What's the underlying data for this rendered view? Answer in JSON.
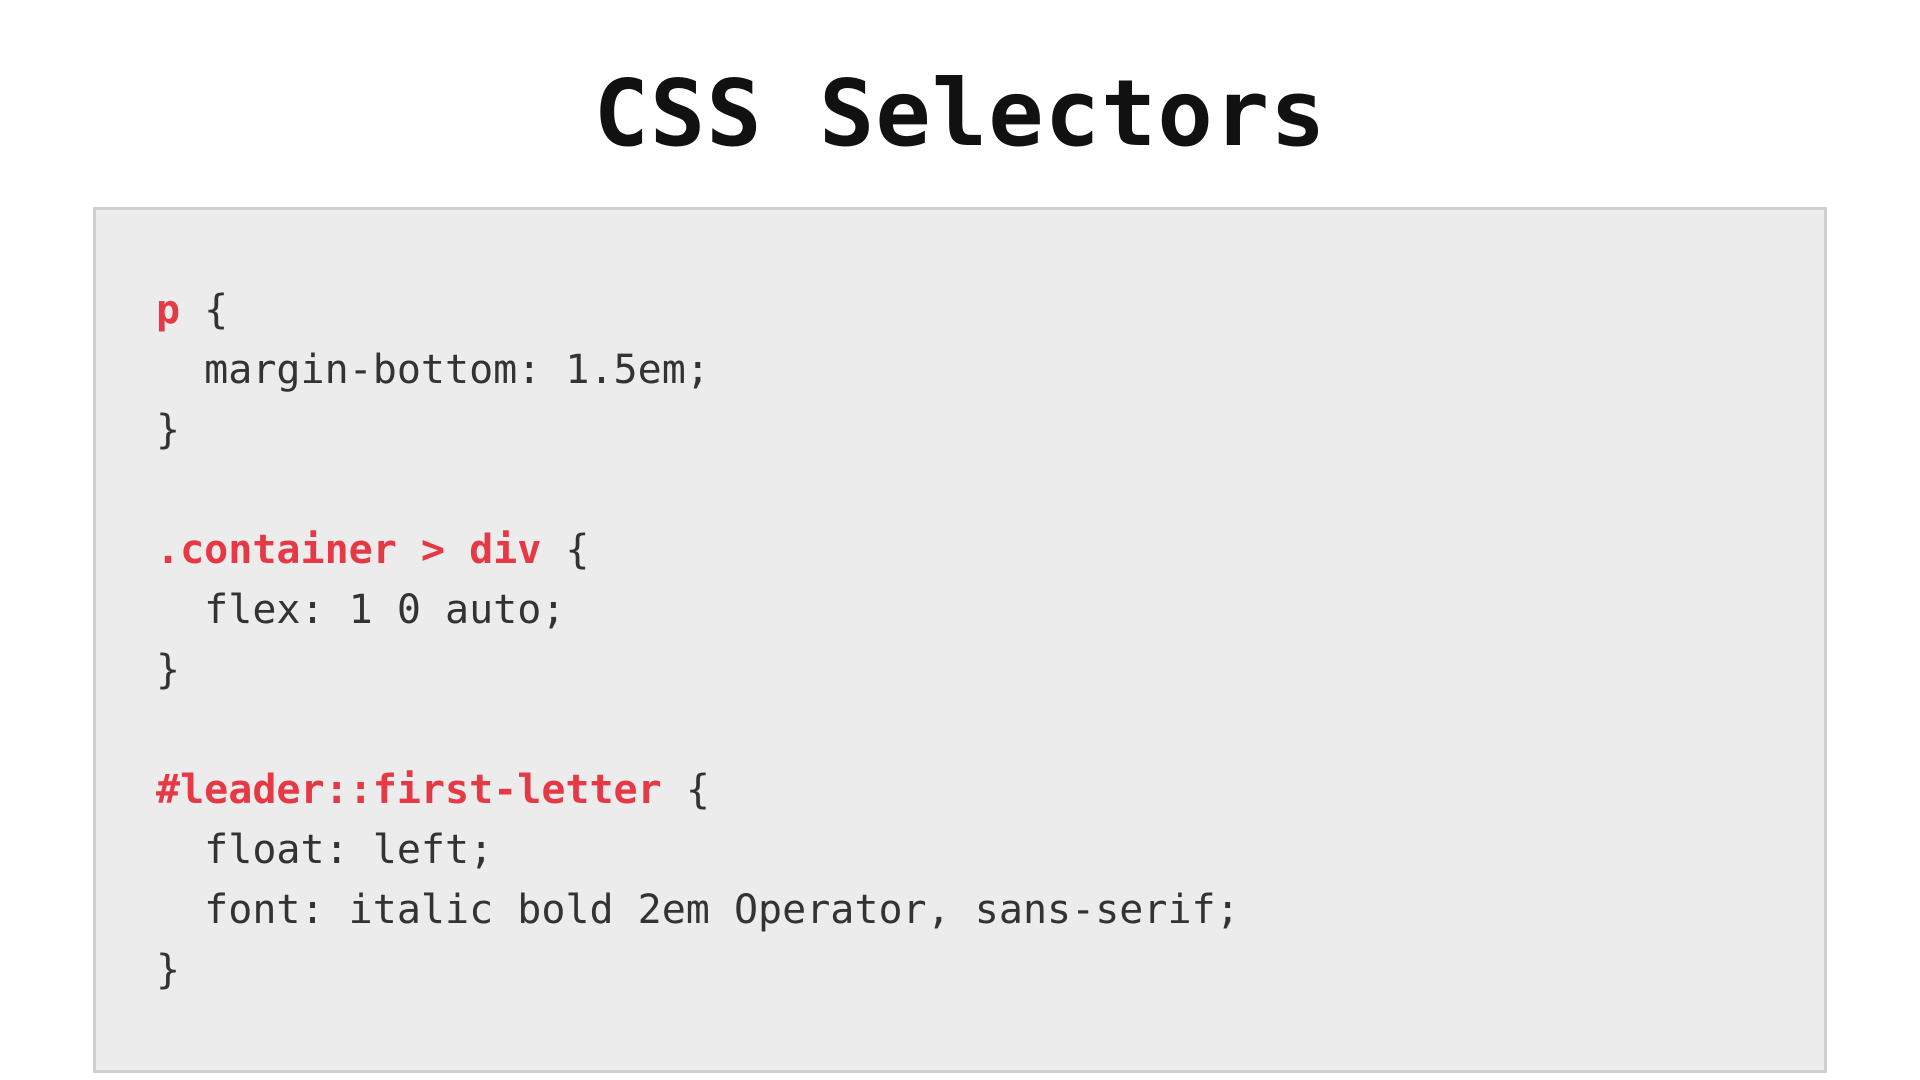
{
  "title": "CSS Selectors",
  "colors": {
    "selector": "#e63946",
    "text": "#333333",
    "box_bg": "#ececec",
    "box_border": "#cfcfcf"
  },
  "code": {
    "r1": {
      "sel": "p",
      "rest": " {"
    },
    "r2": "  margin-bottom: 1.5em;",
    "r3": "}",
    "blank1": "",
    "r4": {
      "sel": ".container > div",
      "rest": " {"
    },
    "r5": "  flex: 1 0 auto;",
    "r6": "}",
    "blank2": "",
    "r7": {
      "sel": "#leader::first-letter",
      "rest": " {"
    },
    "r8": "  float: left;",
    "r9": "  font: italic bold 2em Operator, sans-serif;",
    "r10": "}"
  }
}
